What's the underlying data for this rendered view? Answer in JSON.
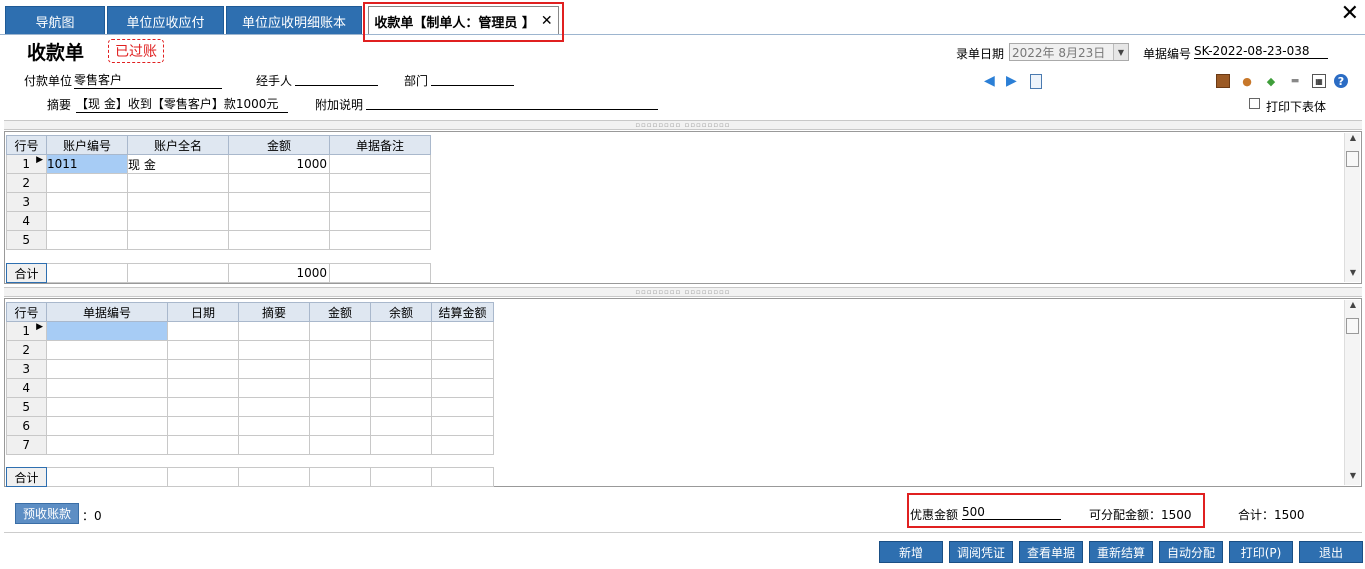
{
  "tabs": [
    {
      "label": "导航图"
    },
    {
      "label": "单位应收应付"
    },
    {
      "label": "单位应收明细账本"
    },
    {
      "label": "收款单【制单人：管理员 】"
    }
  ],
  "header": {
    "title": "收款单",
    "status_stamp": "已过账",
    "date_label": "录单日期",
    "date_value": "2022年  8月23日",
    "doc_no_label": "单据编号",
    "doc_no_value": "SK-2022-08-23-038",
    "payer_label": "付款单位",
    "payer_value": "零售客户",
    "handler_label": "经手人",
    "handler_value": "",
    "dept_label": "部门",
    "dept_value": "",
    "summary_label": "摘要",
    "summary_value": "【现    金】收到【零售客户】款1000元",
    "note_label": "附加说明",
    "note_value": "",
    "print_header_label": "打印下表体"
  },
  "icons": {
    "nav_back": "arrow-left-icon",
    "nav_forward": "arrow-right-icon",
    "doc": "document-icon",
    "door": "door-icon",
    "user": "user-icon",
    "leaf": "leaf-icon",
    "link": "link-icon",
    "grid": "grid-icon",
    "help": "help-icon",
    "close": "close-icon"
  },
  "account_grid": {
    "columns": [
      "行号",
      "账户编号",
      "账户全名",
      "金额",
      "单据备注"
    ],
    "rows": [
      {
        "no": "1",
        "code": "1011",
        "name": "现    金",
        "amount": "1000",
        "remark": ""
      },
      {
        "no": "2",
        "code": "",
        "name": "",
        "amount": "",
        "remark": ""
      },
      {
        "no": "3",
        "code": "",
        "name": "",
        "amount": "",
        "remark": ""
      },
      {
        "no": "4",
        "code": "",
        "name": "",
        "amount": "",
        "remark": ""
      },
      {
        "no": "5",
        "code": "",
        "name": "",
        "amount": "",
        "remark": ""
      }
    ],
    "total_label": "合计",
    "total_amount": "1000"
  },
  "settle_grid": {
    "columns": [
      "行号",
      "单据编号",
      "日期",
      "摘要",
      "金额",
      "余额",
      "结算金额"
    ],
    "rows": [
      {
        "no": "1"
      },
      {
        "no": "2"
      },
      {
        "no": "3"
      },
      {
        "no": "4"
      },
      {
        "no": "5"
      },
      {
        "no": "6"
      },
      {
        "no": "7"
      }
    ],
    "total_label": "合计"
  },
  "footer": {
    "prepay_button": "预收账款",
    "prepay_value": "：0",
    "discount_label": "优惠金额",
    "discount_value": "500",
    "allocatable_label": "可分配金额：1500",
    "total_label": "合计：1500"
  },
  "buttons": [
    "新增",
    "调阅凭证",
    "查看单据",
    "重新结算",
    "自动分配",
    "打印(P)",
    "退出"
  ],
  "colors": {
    "accent": "#2e6fb0",
    "highlight": "#e02020",
    "selected_cell": "#a7ccf5"
  }
}
